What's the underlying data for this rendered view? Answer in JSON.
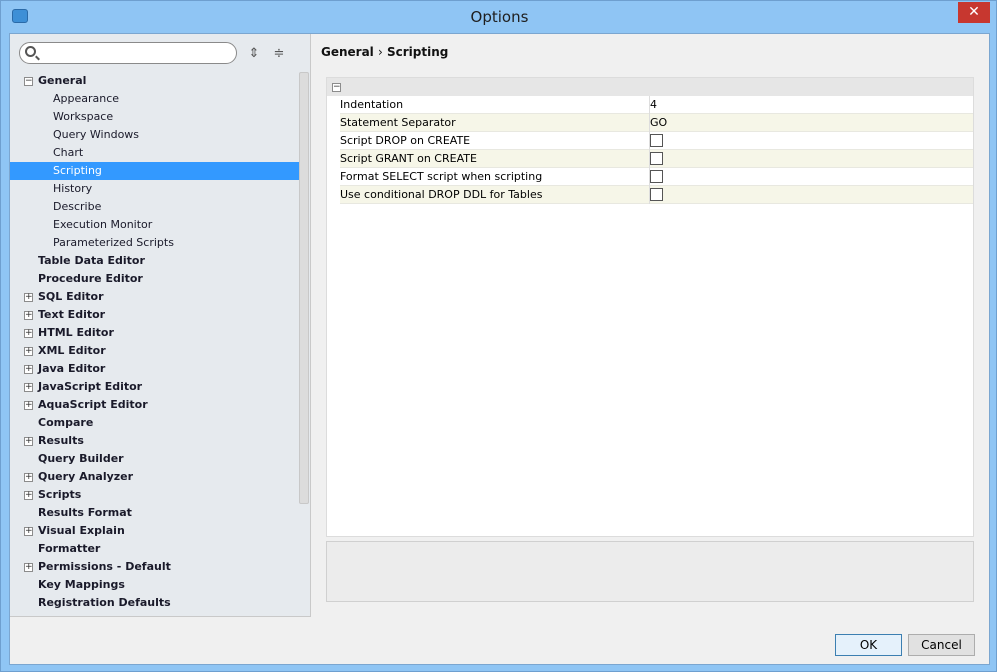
{
  "window": {
    "title": "Options",
    "close_label": "✕"
  },
  "search": {
    "placeholder": ""
  },
  "tree": [
    {
      "label": "General",
      "level": 0,
      "toggle": "−"
    },
    {
      "label": "Appearance",
      "level": 1
    },
    {
      "label": "Workspace",
      "level": 1
    },
    {
      "label": "Query Windows",
      "level": 1
    },
    {
      "label": "Chart",
      "level": 1
    },
    {
      "label": "Scripting",
      "level": 1,
      "selected": true
    },
    {
      "label": "History",
      "level": 1
    },
    {
      "label": "Describe",
      "level": 1
    },
    {
      "label": "Execution Monitor",
      "level": 1
    },
    {
      "label": "Parameterized Scripts",
      "level": 1
    },
    {
      "label": "Table Data Editor",
      "level": 0
    },
    {
      "label": "Procedure Editor",
      "level": 0
    },
    {
      "label": "SQL Editor",
      "level": 0,
      "toggle": "+"
    },
    {
      "label": "Text Editor",
      "level": 0,
      "toggle": "+"
    },
    {
      "label": "HTML Editor",
      "level": 0,
      "toggle": "+"
    },
    {
      "label": "XML Editor",
      "level": 0,
      "toggle": "+"
    },
    {
      "label": "Java Editor",
      "level": 0,
      "toggle": "+"
    },
    {
      "label": "JavaScript Editor",
      "level": 0,
      "toggle": "+"
    },
    {
      "label": "AquaScript Editor",
      "level": 0,
      "toggle": "+"
    },
    {
      "label": "Compare",
      "level": 0
    },
    {
      "label": "Results",
      "level": 0,
      "toggle": "+"
    },
    {
      "label": "Query Builder",
      "level": 0
    },
    {
      "label": "Query Analyzer",
      "level": 0,
      "toggle": "+"
    },
    {
      "label": "Scripts",
      "level": 0,
      "toggle": "+"
    },
    {
      "label": "Results Format",
      "level": 0
    },
    {
      "label": "Visual Explain",
      "level": 0,
      "toggle": "+"
    },
    {
      "label": "Formatter",
      "level": 0
    },
    {
      "label": "Permissions - Default",
      "level": 0,
      "toggle": "+"
    },
    {
      "label": "Key Mappings",
      "level": 0
    },
    {
      "label": "Registration Defaults",
      "level": 0
    }
  ],
  "breadcrumb": {
    "parent": "General",
    "separator": "›",
    "current": "Scripting"
  },
  "properties": [
    {
      "label": "Indentation",
      "value": "4"
    },
    {
      "label": "Statement Separator",
      "value": "GO"
    },
    {
      "label": "Script DROP on CREATE",
      "checked": false
    },
    {
      "label": "Script GRANT on CREATE",
      "checked": false
    },
    {
      "label": "Format SELECT script when scripting",
      "checked": false
    },
    {
      "label": "Use conditional DROP DDL for Tables",
      "checked": false
    }
  ],
  "buttons": {
    "ok": "OK",
    "cancel": "Cancel"
  }
}
